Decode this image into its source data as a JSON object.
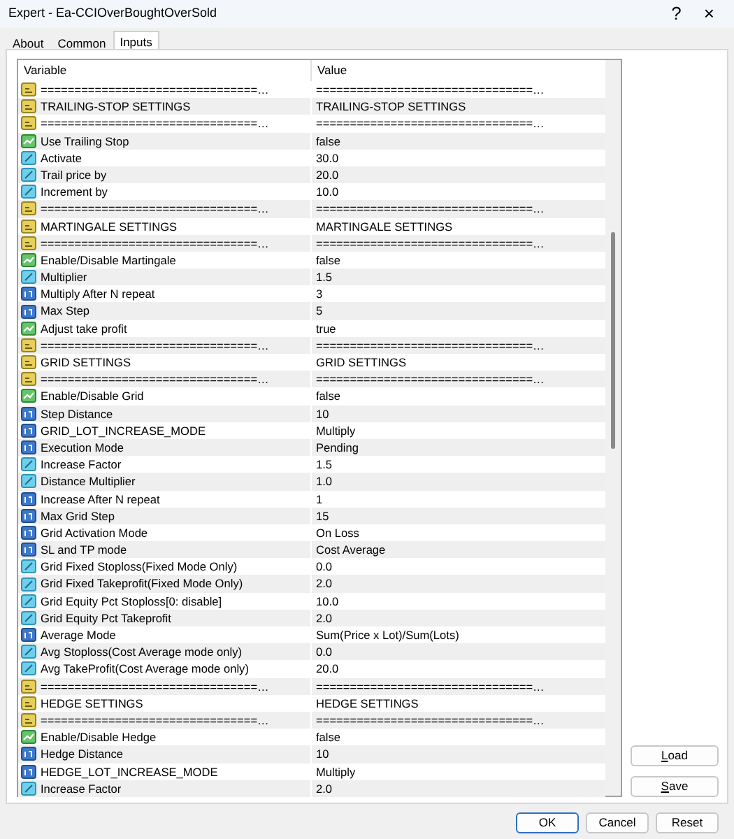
{
  "window": {
    "title": "Expert - Ea-CCIOverBoughtOverSold",
    "help": "?",
    "close": "×"
  },
  "tabs": [
    {
      "label": "About",
      "selected": false
    },
    {
      "label": "Common",
      "selected": false
    },
    {
      "label": "Inputs",
      "selected": true
    }
  ],
  "table": {
    "columns": [
      "Variable",
      "Value"
    ],
    "rows": [
      {
        "kind": "string",
        "variable": "================================…",
        "value": "================================…"
      },
      {
        "kind": "string",
        "variable": "TRAILING-STOP SETTINGS",
        "value": "TRAILING-STOP SETTINGS"
      },
      {
        "kind": "string",
        "variable": "================================…",
        "value": "================================…"
      },
      {
        "kind": "bool",
        "variable": "Use Trailing Stop",
        "value": "false"
      },
      {
        "kind": "double",
        "variable": "Activate",
        "value": "30.0"
      },
      {
        "kind": "double",
        "variable": "Trail price by",
        "value": "20.0"
      },
      {
        "kind": "double",
        "variable": "Increment by",
        "value": "10.0"
      },
      {
        "kind": "string",
        "variable": "================================…",
        "value": "================================…"
      },
      {
        "kind": "string",
        "variable": "MARTINGALE SETTINGS",
        "value": "MARTINGALE SETTINGS"
      },
      {
        "kind": "string",
        "variable": "================================…",
        "value": "================================…"
      },
      {
        "kind": "bool",
        "variable": "Enable/Disable Martingale",
        "value": "false"
      },
      {
        "kind": "double",
        "variable": "Multiplier",
        "value": "1.5"
      },
      {
        "kind": "int",
        "variable": "Multiply After N repeat",
        "value": "3"
      },
      {
        "kind": "int",
        "variable": "Max Step",
        "value": "5"
      },
      {
        "kind": "bool",
        "variable": "Adjust take profit",
        "value": "true"
      },
      {
        "kind": "string",
        "variable": "================================…",
        "value": "================================…"
      },
      {
        "kind": "string",
        "variable": "GRID SETTINGS",
        "value": "GRID SETTINGS"
      },
      {
        "kind": "string",
        "variable": "================================…",
        "value": "================================…"
      },
      {
        "kind": "bool",
        "variable": "Enable/Disable Grid",
        "value": "false"
      },
      {
        "kind": "int",
        "variable": "Step Distance",
        "value": "10"
      },
      {
        "kind": "int",
        "variable": "GRID_LOT_INCREASE_MODE",
        "value": "Multiply"
      },
      {
        "kind": "int",
        "variable": "Execution Mode",
        "value": "Pending"
      },
      {
        "kind": "double",
        "variable": "Increase Factor",
        "value": "1.5"
      },
      {
        "kind": "double",
        "variable": "Distance Multiplier",
        "value": "1.0"
      },
      {
        "kind": "int",
        "variable": "Increase After N repeat",
        "value": "1"
      },
      {
        "kind": "int",
        "variable": "Max Grid Step",
        "value": "15"
      },
      {
        "kind": "int",
        "variable": "Grid Activation Mode",
        "value": "On Loss"
      },
      {
        "kind": "int",
        "variable": "SL and TP mode",
        "value": "Cost Average"
      },
      {
        "kind": "double",
        "variable": "Grid Fixed Stoploss(Fixed Mode Only)",
        "value": "0.0"
      },
      {
        "kind": "double",
        "variable": "Grid Fixed Takeprofit(Fixed Mode Only)",
        "value": "2.0"
      },
      {
        "kind": "double",
        "variable": "Grid Equity Pct Stoploss[0: disable]",
        "value": "10.0"
      },
      {
        "kind": "double",
        "variable": "Grid Equity Pct Takeprofit",
        "value": "2.0"
      },
      {
        "kind": "int",
        "variable": "Average Mode",
        "value": "Sum(Price x Lot)/Sum(Lots)"
      },
      {
        "kind": "double",
        "variable": "Avg Stoploss(Cost Average mode only)",
        "value": "0.0"
      },
      {
        "kind": "double",
        "variable": "Avg TakeProfit(Cost Average mode only)",
        "value": "20.0"
      },
      {
        "kind": "string",
        "variable": "================================…",
        "value": "================================…"
      },
      {
        "kind": "string",
        "variable": "HEDGE SETTINGS",
        "value": "HEDGE SETTINGS"
      },
      {
        "kind": "string",
        "variable": "================================…",
        "value": "================================…"
      },
      {
        "kind": "bool",
        "variable": "Enable/Disable Hedge",
        "value": "false"
      },
      {
        "kind": "int",
        "variable": "Hedge Distance",
        "value": "10"
      },
      {
        "kind": "int",
        "variable": "HEDGE_LOT_INCREASE_MODE",
        "value": "Multiply"
      },
      {
        "kind": "double",
        "variable": "Increase Factor",
        "value": "2.0"
      }
    ]
  },
  "side_buttons": [
    "Load",
    "Save"
  ],
  "buttons": [
    {
      "label": "OK",
      "default": true
    },
    {
      "label": "Cancel",
      "default": false
    },
    {
      "label": "Reset",
      "default": false
    }
  ]
}
